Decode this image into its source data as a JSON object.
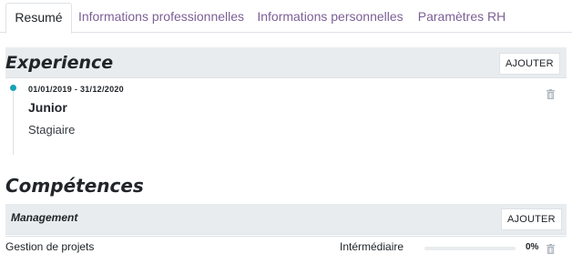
{
  "tabs": [
    {
      "label": "Resumé",
      "active": true
    },
    {
      "label": "Informations professionnelles",
      "active": false
    },
    {
      "label": "Informations personnelles",
      "active": false
    },
    {
      "label": "Paramètres RH",
      "active": false
    }
  ],
  "experience": {
    "title": "Experience",
    "add_label": "AJOUTER",
    "entries": [
      {
        "dates": "01/01/2019 - 31/12/2020",
        "title": "Junior",
        "subtitle": "Stagiaire"
      }
    ]
  },
  "competences": {
    "title": "Compétences",
    "groups": [
      {
        "name": "Management",
        "add_label": "AJOUTER",
        "skills": [
          {
            "name": "Gestion de projets",
            "level": "Intérmédiaire",
            "progress": 0,
            "progress_label": "0%"
          }
        ]
      }
    ]
  },
  "colors": {
    "accent": "#7c5f96",
    "timeline_dot": "#17a2b8",
    "section_bg": "#e9ecef"
  },
  "icons": {
    "delete": "trash-icon"
  }
}
